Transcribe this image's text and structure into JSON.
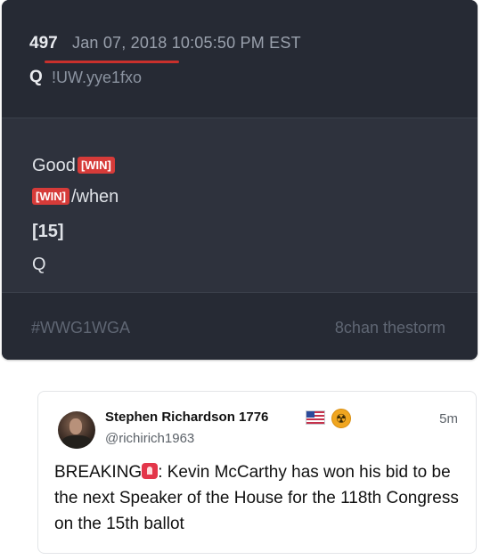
{
  "qpost": {
    "number": "497",
    "date": "Jan 07, 2018 10:05:50 PM EST",
    "author": "Q",
    "tripcode": "!UW.yye1fxo",
    "lines": {
      "line1_text": "Good",
      "line1_tag": "[WIN]",
      "line2_tag": "[WIN]",
      "line2_text": "/when",
      "line3": "[15]",
      "line4": "Q"
    },
    "footer": {
      "hashtag": "#WWG1WGA",
      "board": "8chan thestorm"
    },
    "colors": {
      "card_bg": "#2e323d",
      "header_bg": "#262a34",
      "tag_bg": "#d63b39",
      "underline": "#c9302c"
    }
  },
  "tweet": {
    "name": "Stephen Richardson 1776",
    "name_icons": [
      "us-flag-icon",
      "radioactive-icon"
    ],
    "handle": "@richirich1963",
    "time": "5m",
    "text_before_icon": "BREAKING",
    "inline_icon": "siren-icon",
    "text_after_icon": ": Kevin McCarthy has won his bid to be the next Speaker of the House for the 118th Congress on the 15th ballot"
  }
}
